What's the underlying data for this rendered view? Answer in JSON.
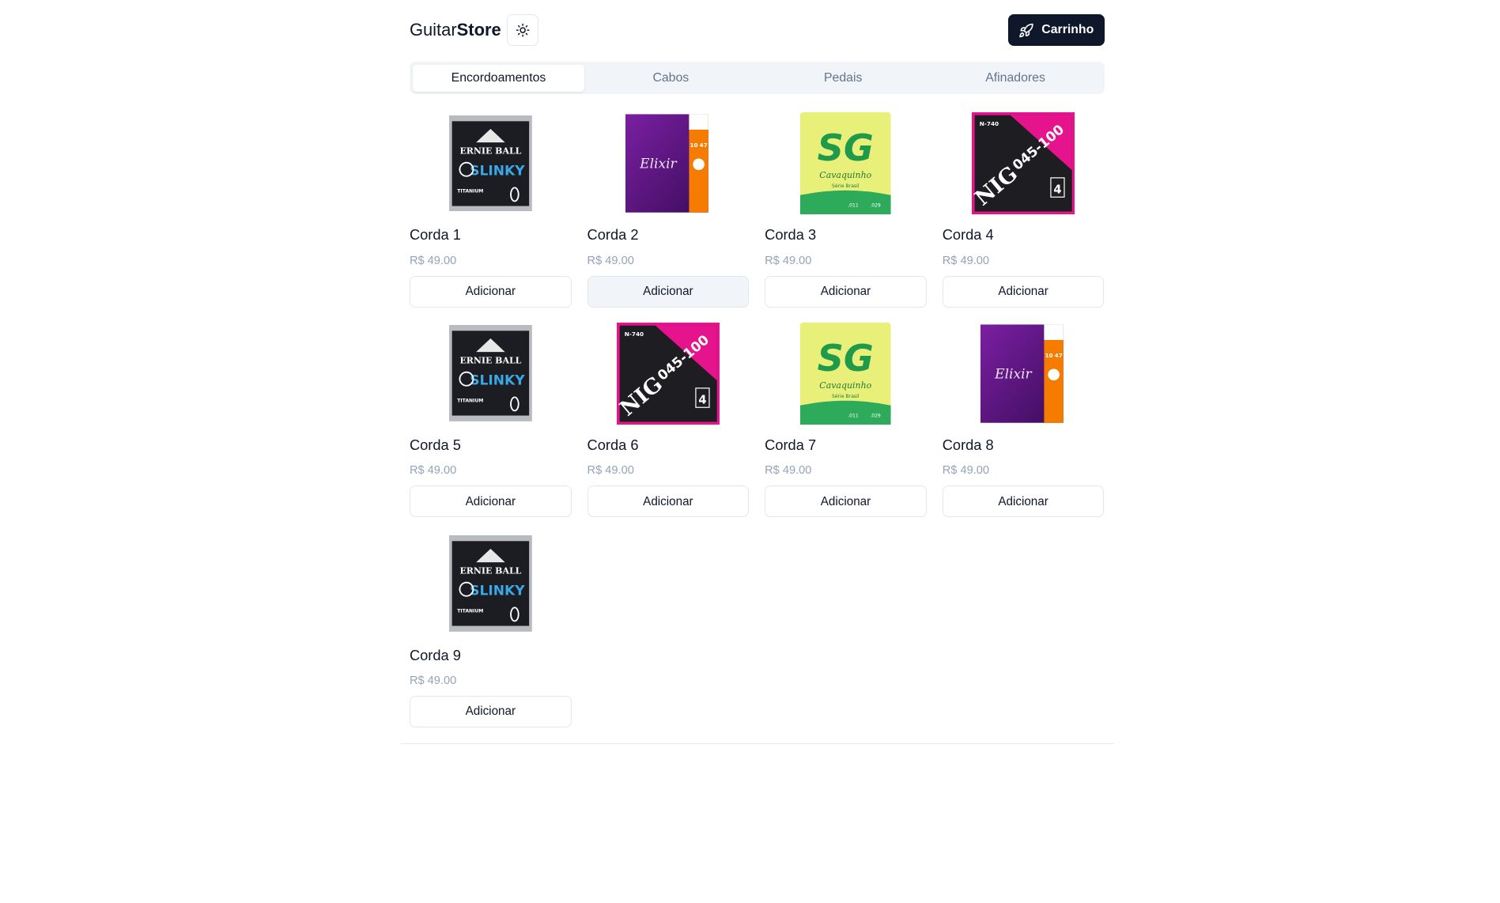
{
  "brand": {
    "part1": "Guitar",
    "part2": "Store"
  },
  "header": {
    "cart_label": "Carrinho",
    "theme_icon": "sun-icon",
    "cart_icon": "rocket-icon"
  },
  "tabs": [
    {
      "label": "Encordoamentos",
      "active": true
    },
    {
      "label": "Cabos",
      "active": false
    },
    {
      "label": "Pedais",
      "active": false
    },
    {
      "label": "Afinadores",
      "active": false
    }
  ],
  "products": [
    {
      "name": "Corda 1",
      "price": "R$ 49.00",
      "button": "Adicionar",
      "package": "ernie-ball-slinky"
    },
    {
      "name": "Corda 2",
      "price": "R$ 49.00",
      "button": "Adicionar",
      "package": "elixir"
    },
    {
      "name": "Corda 3",
      "price": "R$ 49.00",
      "button": "Adicionar",
      "package": "sg-cavaquinho"
    },
    {
      "name": "Corda 4",
      "price": "R$ 49.00",
      "button": "Adicionar",
      "package": "nig-045-100"
    },
    {
      "name": "Corda 5",
      "price": "R$ 49.00",
      "button": "Adicionar",
      "package": "ernie-ball-slinky"
    },
    {
      "name": "Corda 6",
      "price": "R$ 49.00",
      "button": "Adicionar",
      "package": "nig-045-100"
    },
    {
      "name": "Corda 7",
      "price": "R$ 49.00",
      "button": "Adicionar",
      "package": "sg-cavaquinho"
    },
    {
      "name": "Corda 8",
      "price": "R$ 49.00",
      "button": "Adicionar",
      "package": "elixir"
    },
    {
      "name": "Corda 9",
      "price": "R$ 49.00",
      "button": "Adicionar",
      "package": "ernie-ball-slinky"
    }
  ],
  "package_text": {
    "ernie": {
      "brand": "ERNIE BALL",
      "line": "SLINKY",
      "sub": "TITANIUM"
    },
    "elixir": {
      "brand": "Elixir",
      "gauge1": "10",
      "gauge2": "47"
    },
    "sg": {
      "brand": "SG",
      "model": "Cavaquinho",
      "series": "Série Brasil",
      "g1": ".011",
      "g2": ".029"
    },
    "nig": {
      "code": "N-740",
      "brand": "NIG",
      "gauge": "045-100",
      "strings": "4"
    }
  },
  "colors": {
    "primary": "#0f172a",
    "muted": "#64748b",
    "price": "#94a3b8",
    "border": "#e2e8f0",
    "tabs_bg": "#f1f5f9"
  }
}
